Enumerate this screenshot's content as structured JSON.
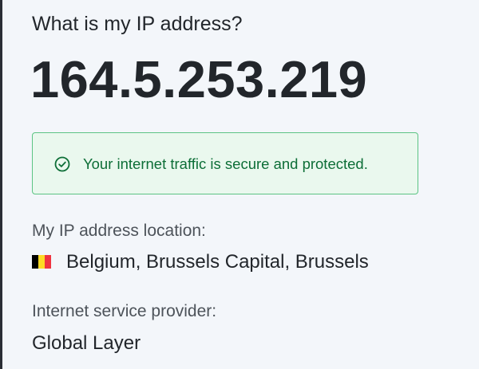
{
  "header": {
    "question": "What is my IP address?"
  },
  "ip": {
    "address": "164.5.253.219"
  },
  "security": {
    "message": "Your internet traffic is secure and protected.",
    "icon": "check-circle-icon",
    "accent_color": "#0d6e37",
    "background_color": "#eaf8ee",
    "border_color": "#5cc484"
  },
  "location": {
    "label": "My IP address location:",
    "value": "Belgium, Brussels Capital, Brussels",
    "flag_icon": "belgium-flag-icon",
    "flag_colors": [
      "#000000",
      "#fdda24",
      "#ef3340"
    ]
  },
  "isp": {
    "label": "Internet service provider:",
    "value": "Global Layer"
  }
}
